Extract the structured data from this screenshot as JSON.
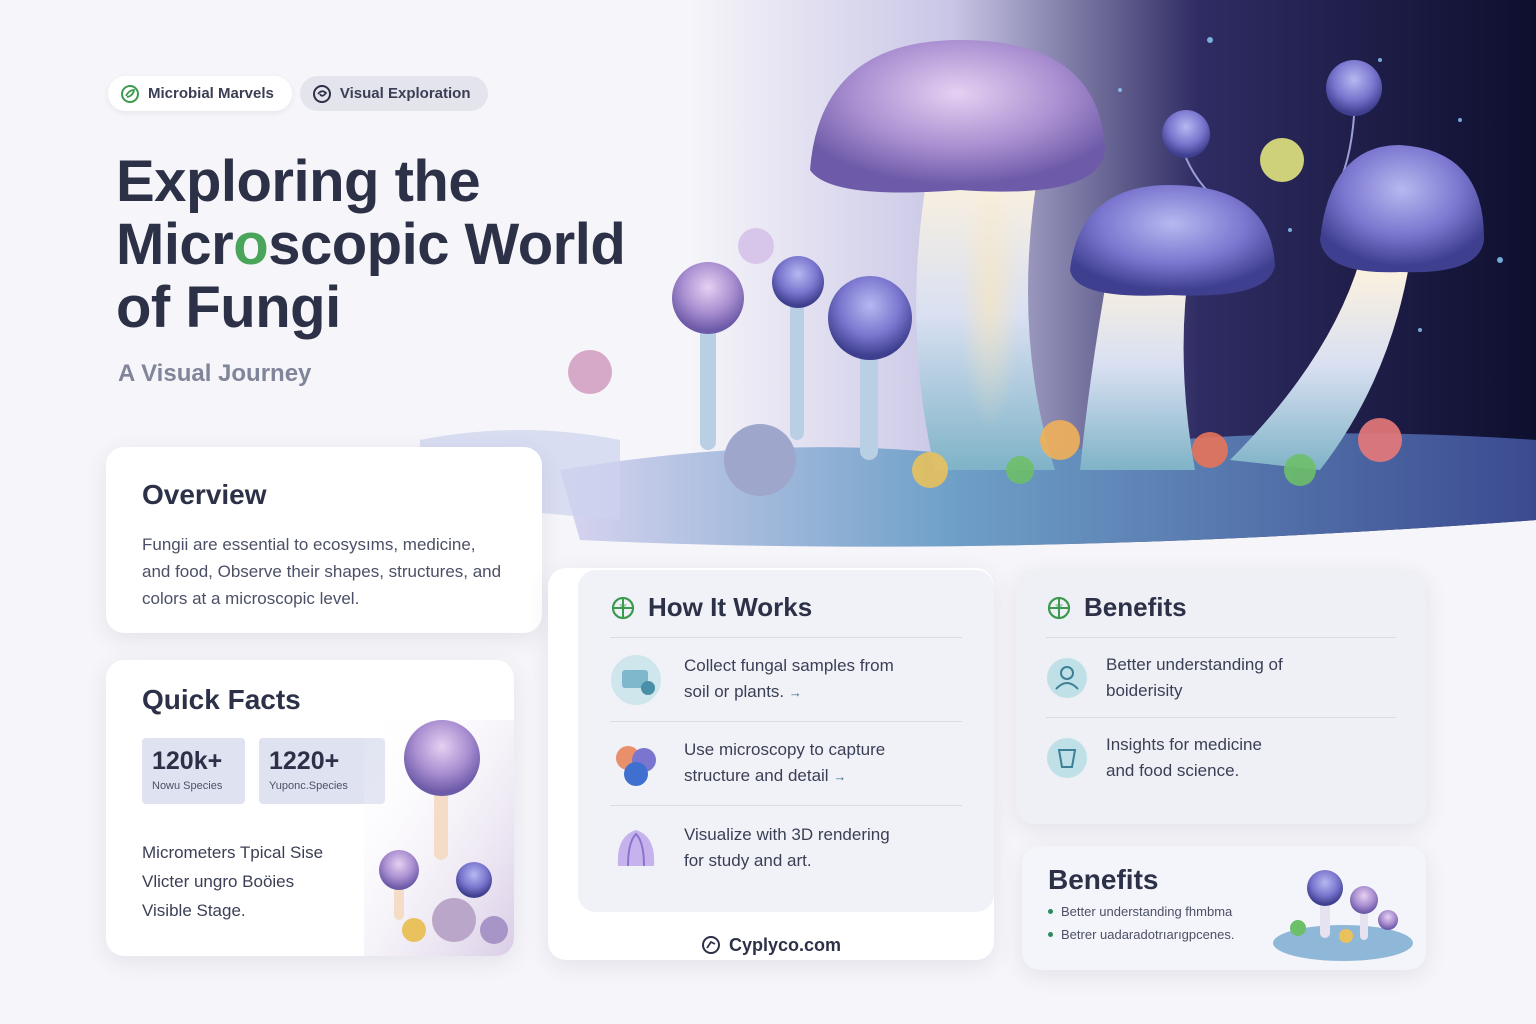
{
  "chips": [
    {
      "label": "Microbial Marvels",
      "icon": "leaf-check-icon"
    },
    {
      "label": "Visual Exploration",
      "icon": "swirl-icon"
    }
  ],
  "hero": {
    "title_line1": "Exploring the",
    "title_line2_pre": "Micr",
    "title_line2_dot": "o",
    "title_line2_post": "scopic World",
    "title_line3": "of Fungi",
    "subtitle": "A Visual Journey"
  },
  "overview": {
    "title": "Overview",
    "body": "Fungii are essential to ecosysıms, medicine, and food, Observe their shapes, structures, and colors at a microscopic level."
  },
  "quick_facts": {
    "title": "Quick Facts",
    "stats": [
      {
        "value": "120k+",
        "label": "Nowu Species"
      },
      {
        "value": "1220+",
        "label": "Yuponc.Species"
      }
    ],
    "lines": [
      "Micrometers Tpical Sise",
      "Vlicter ungro Boöies",
      "Visible Stage."
    ]
  },
  "how_it_works": {
    "title": "How It Works",
    "icon": "compass-icon",
    "steps": [
      {
        "line1": "Collect fungal samples from",
        "line2": "soil or plants.",
        "arrow": "→"
      },
      {
        "line1": "Use microscopy to capture",
        "line2": "structure and detail",
        "arrow": "→"
      },
      {
        "line1": "Visualize with 3D rendering",
        "line2": "for study and art.",
        "arrow": ""
      }
    ]
  },
  "footer": {
    "link": "Cyplyco.com"
  },
  "benefits": {
    "title": "Benefits",
    "icon": "compass-icon",
    "items": [
      {
        "line1": "Better understanding of",
        "line2": "boiderisity"
      },
      {
        "line1": "Insights for medicine",
        "line2": "and food science."
      }
    ]
  },
  "benefits_secondary": {
    "title": "Benefits",
    "bullets": [
      "Better understanding fhmbma",
      "Betrer uadaradotrıarıgpcenes."
    ]
  },
  "colors": {
    "title": "#2d3148",
    "accent_green": "#4aa45a",
    "card_bg": "#ffffff",
    "page_bg": "#f6f5f9"
  }
}
